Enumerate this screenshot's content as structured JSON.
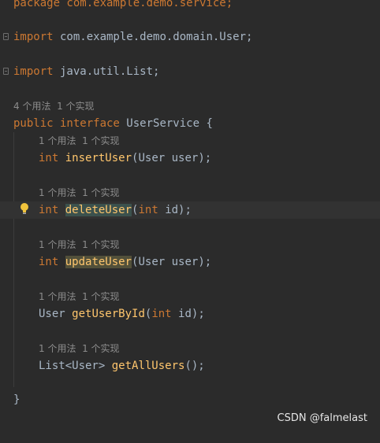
{
  "code": {
    "package_line": "package com.example.demo.service;",
    "import_1": {
      "keyword": "import",
      "rest": " com.example.demo.domain.User;"
    },
    "import_2": {
      "keyword": "import",
      "rest": " java.util.List;"
    },
    "interface_hint": "4 个用法  1 个实现",
    "interface_decl": {
      "mod": "public",
      "kw": " interface",
      "rest": " UserService {"
    },
    "method_hint": "1 个用法  1 个实现",
    "methods": [
      {
        "ret": "int",
        "name": "insertUser",
        "params_prefix": "(User user);",
        "param_kw": "",
        "params_suffix": ""
      },
      {
        "ret": "int",
        "name": "deleteUser",
        "params_prefix": "(",
        "param_kw": "int",
        "params_suffix": " id);"
      },
      {
        "ret": "int",
        "name": "updateUser",
        "params_prefix": "(User user);",
        "param_kw": "",
        "params_suffix": ""
      },
      {
        "ret_plain": "User",
        "name": "getUserById",
        "params_prefix": "(",
        "param_kw": "int",
        "params_suffix": " id);"
      },
      {
        "ret_plain": "List<User>",
        "name": "getAllUsers",
        "params_prefix": "();",
        "param_kw": "",
        "params_suffix": ""
      }
    ],
    "closing_brace": "}"
  },
  "watermark": "CSDN @falmelast",
  "colors": {
    "background": "#2b2b2b",
    "keyword": "#cc7832",
    "function": "#ffc66d",
    "text": "#a9b7c6",
    "hint": "#8c8c8c"
  },
  "icons": {
    "fold": "fold-marker-icon",
    "intention": "lightbulb-icon"
  }
}
